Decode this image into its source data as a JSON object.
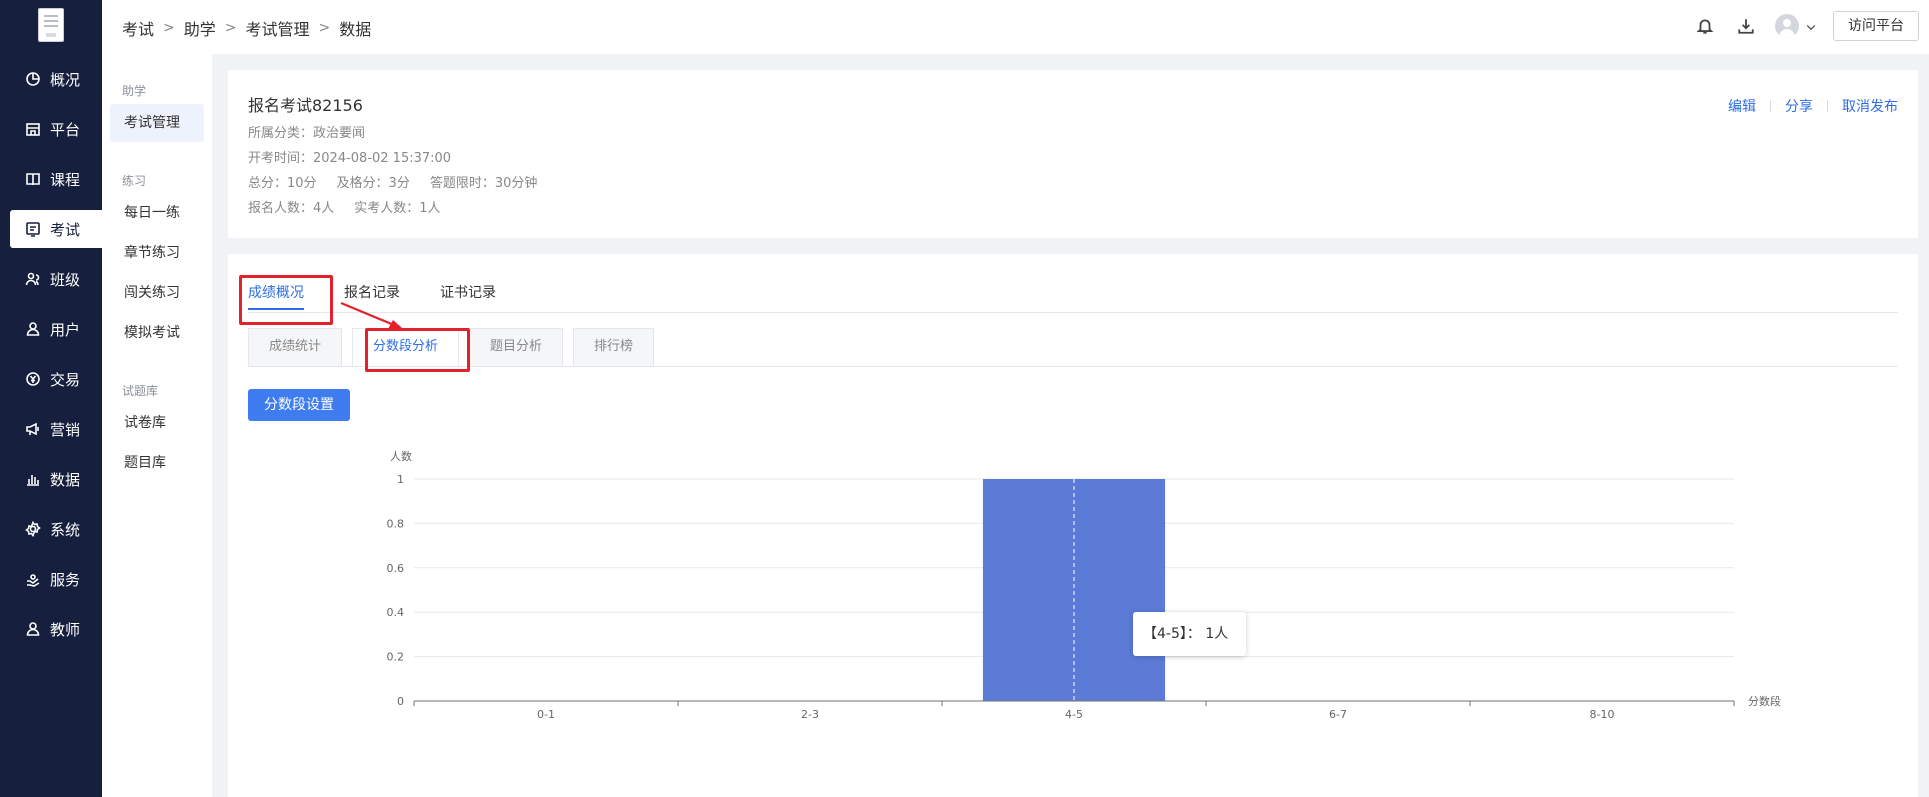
{
  "nav": {
    "items": [
      {
        "label": "概况",
        "icon": "pie-chart-icon"
      },
      {
        "label": "平台",
        "icon": "storefront-icon"
      },
      {
        "label": "课程",
        "icon": "book-icon"
      },
      {
        "label": "考试",
        "icon": "exam-icon",
        "active": true
      },
      {
        "label": "班级",
        "icon": "group-icon"
      },
      {
        "label": "用户",
        "icon": "user-icon"
      },
      {
        "label": "交易",
        "icon": "yen-icon"
      },
      {
        "label": "营销",
        "icon": "megaphone-icon"
      },
      {
        "label": "数据",
        "icon": "bar-chart-icon"
      },
      {
        "label": "系统",
        "icon": "settings-icon"
      },
      {
        "label": "服务",
        "icon": "service-icon"
      },
      {
        "label": "教师",
        "icon": "teacher-icon"
      }
    ]
  },
  "subnav": {
    "groups": [
      {
        "title": "助学",
        "items": [
          "考试管理"
        ]
      },
      {
        "title": "练习",
        "items": [
          "每日一练",
          "章节练习",
          "闯关练习",
          "模拟考试"
        ]
      },
      {
        "title": "试题库",
        "items": [
          "试卷库",
          "题目库"
        ]
      }
    ]
  },
  "breadcrumb": [
    "考试",
    "助学",
    "考试管理",
    "数据"
  ],
  "topbar": {
    "visit_label": "访问平台"
  },
  "exam": {
    "title": "报名考试82156",
    "category": "所属分类：政治要闻",
    "start_time": "开考时间：2024-08-02 15:37:00",
    "total_score": "总分：10分",
    "pass_score": "及格分：3分",
    "time_limit": "答题限时：30分钟",
    "registered": "报名人数：4人",
    "actual": "实考人数：1人",
    "actions": [
      "编辑",
      "分享",
      "取消发布"
    ]
  },
  "tabs": [
    "成绩概况",
    "报名记录",
    "证书记录"
  ],
  "subtabs": [
    "成绩统计",
    "分数段分析",
    "题目分析",
    "排行榜"
  ],
  "segment_button": "分数段设置",
  "chart_data": {
    "type": "bar",
    "ylabel": "人数",
    "xlabel": "分数段",
    "categories": [
      "0-1",
      "2-3",
      "4-5",
      "6-7",
      "8-10"
    ],
    "values": [
      0,
      0,
      1,
      0,
      0
    ],
    "ylim": [
      0,
      1
    ],
    "yticks": [
      "0",
      "0.2",
      "0.4",
      "0.6",
      "0.8",
      "1"
    ],
    "bar_color": "#5b7bd6",
    "grid": true
  },
  "tooltip": "【4-5】： 1人",
  "colors": {
    "accent": "#2d6ee8",
    "nav_bg": "#161f3d",
    "highlight": "#e4212b"
  }
}
